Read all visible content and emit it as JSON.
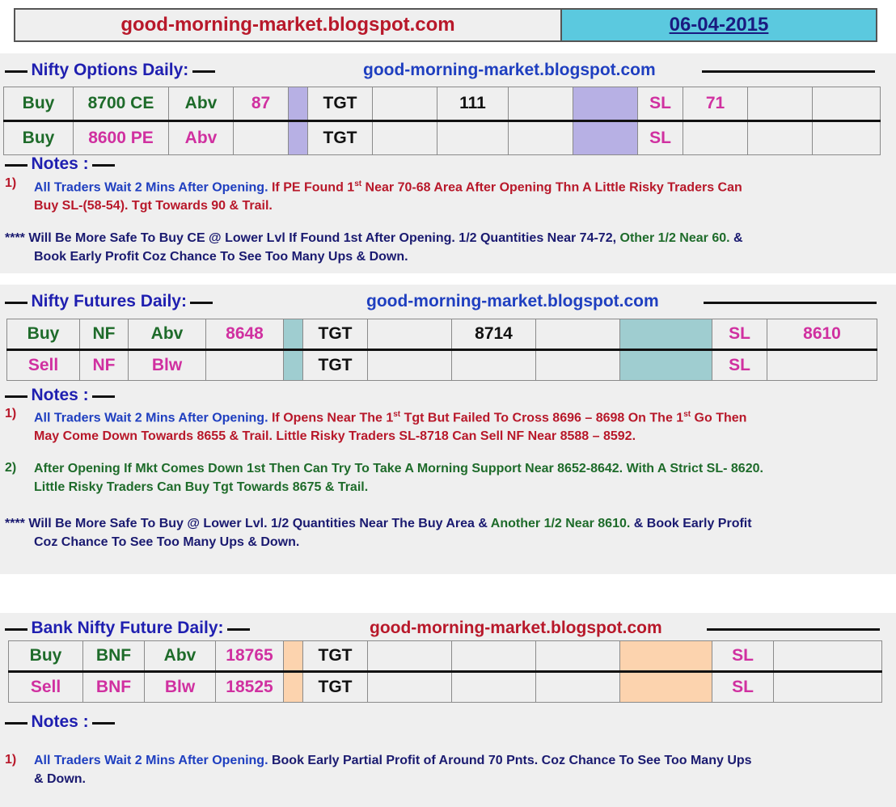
{
  "header": {
    "site": "good-morning-market.blogspot.com",
    "date": "06-04-2015"
  },
  "options": {
    "title": "Nifty  Options  Daily:",
    "site": "good-morning-market.blogspot.com",
    "rows": [
      [
        "Buy",
        "8700 CE",
        "Abv",
        "87",
        "",
        "TGT",
        "",
        "111",
        "",
        "",
        "SL",
        "71",
        "",
        ""
      ],
      [
        "Buy",
        "8600 PE",
        "Abv",
        "",
        "",
        "TGT",
        "",
        "",
        "",
        "",
        "SL",
        "",
        "",
        ""
      ]
    ],
    "notes_title": "Notes :",
    "note1_num": "1)",
    "note1_a": "All Traders Wait 2 Mins After Opening.",
    "note1_b": " If PE Found 1",
    "note1_sup": "st",
    "note1_c": " Near 70-68 Area After Opening Thn A Little Risky Traders Can",
    "note1_d": "Buy SL-(58-54). Tgt Towards 90 & Trail.",
    "note2_a": "**** Will Be More Safe To Buy CE @ Lower Lvl If Found 1st After Opening.  1/2  Quantities Near 74-72,",
    "note2_b": " Other 1/2  Near 60.",
    "note2_c": " &",
    "note2_d": "Book Early Profit Coz Chance To See Too Many Ups & Down."
  },
  "futures": {
    "title": "Nifty Futures  Daily:",
    "site": "good-morning-market.blogspot.com",
    "rows": [
      [
        "Buy",
        "NF",
        "Abv",
        "8648",
        "",
        "TGT",
        "",
        "8714",
        "",
        "",
        "SL",
        "8610"
      ],
      [
        "Sell",
        "NF",
        "Blw",
        "",
        "",
        "TGT",
        "",
        "",
        "",
        "",
        "SL",
        ""
      ]
    ],
    "notes_title": "Notes :",
    "note1_num": "1)",
    "note1_a": "All Traders Wait  2 Mins After Opening.",
    "note1_b": " If Opens Near The 1",
    "note1_sup": "st",
    "note1_c": " Tgt But Failed To Cross 8696 – 8698 On The 1",
    "note1_sup2": "st",
    "note1_d": " Go Then",
    "note1_e": "May Come Down Towards 8655 & Trail. Little Risky Traders SL-8718 Can Sell NF Near 8588 – 8592.",
    "note2_num": "2)",
    "note2_a": "After Opening If Mkt Comes Down 1st Then Can Try To Take A Morning Support Near 8652-8642. With A Strict SL- 8620.",
    "note2_b": "Little Risky Traders Can Buy Tgt Towards 8675 & Trail.",
    "note3_a": "**** Will Be More Safe To Buy @ Lower Lvl.  1/2  Quantities Near The Buy Area &",
    "note3_b": " Another 1/2 Near 8610.",
    "note3_c": "  & Book Early Profit",
    "note3_d": "Coz Chance To See Too Many Ups & Down."
  },
  "banknifty": {
    "title": "Bank Nifty Future  Daily:",
    "site": "good-morning-market.blogspot.com",
    "rows": [
      [
        "Buy",
        "BNF",
        "Abv",
        "18765",
        "",
        "TGT",
        "",
        "",
        "",
        "",
        "SL",
        ""
      ],
      [
        "Sell",
        "BNF",
        "Blw",
        "18525",
        "",
        "TGT",
        "",
        "",
        "",
        "",
        "SL",
        ""
      ]
    ],
    "notes_title": "Notes :",
    "note1_num": "1)",
    "note1_a": "All Traders Wait  2 Mins After Opening.",
    "note1_b": " Book Early Partial Profit of Around 70 Pnts. Coz Chance To See Too Many Ups",
    "note1_c": "& Down."
  }
}
